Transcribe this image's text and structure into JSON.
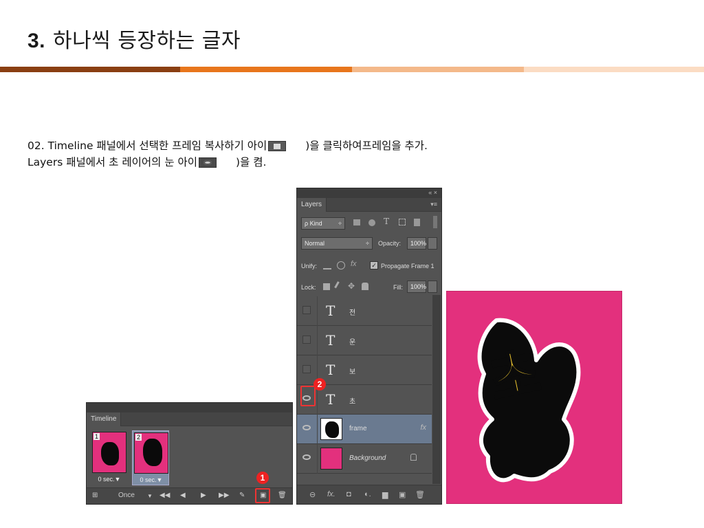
{
  "slide": {
    "title_num": "3.",
    "title_text": "하나씩 등장하는 글자",
    "bar_colors": [
      "#8a3f12",
      "#e8761c",
      "#f4b98a",
      "#fbdcc3"
    ]
  },
  "description": {
    "line1_a": "02. Timeline 패널에서 선택한 프레임 복사하기 아이",
    "line1_b": ")을 클릭하여프레임을 추가.",
    "line2_a": "Layers 패널에서 초 레이어의 눈 아이",
    "line2_b": ")을 켬."
  },
  "timeline": {
    "tab": "Timeline",
    "frames": [
      {
        "index": "1",
        "delay": "0 sec.▼",
        "selected": false
      },
      {
        "index": "2",
        "delay": "0 sec.▼",
        "selected": true
      }
    ],
    "loop": "Once",
    "loop_arrow": "▼",
    "controls": [
      "⊞",
      "◀◀",
      "◀",
      "▶",
      "▶▶",
      "✎",
      "▣",
      "🗑"
    ],
    "badge": "1"
  },
  "layers_panel": {
    "collapse": "«  ×",
    "tab": "Layers",
    "menu": "▾≡",
    "kind": "ρ Kind",
    "kind_arrow": "÷",
    "blend": "Normal",
    "blend_arrow": "÷",
    "opacity_label": "Opacity:",
    "opacity_value": "100%",
    "unify_label": "Unify:",
    "propagate": "Propagate Frame 1",
    "propagate_check": "✓",
    "lock_label": "Lock:",
    "fill_label": "Fill:",
    "fill_value": "100%",
    "badge": "2",
    "layers": [
      {
        "name": "전",
        "type": "text",
        "visible": false
      },
      {
        "name": "운",
        "type": "text",
        "visible": false
      },
      {
        "name": "보",
        "type": "text",
        "visible": false
      },
      {
        "name": "초",
        "type": "text",
        "visible": true
      },
      {
        "name": "frame",
        "type": "image",
        "visible": true,
        "selected": true,
        "fx": "fx"
      },
      {
        "name": "Background",
        "type": "fill",
        "visible": true,
        "locked": true,
        "color": "#e3307d"
      }
    ],
    "footer": [
      "⊖",
      "fx.",
      "◘",
      "◐.",
      "▆",
      "▣",
      "🗑"
    ]
  },
  "preview": {
    "background": "#e3307d",
    "glyph": "초",
    "glyph_color": "#f4cb30"
  }
}
